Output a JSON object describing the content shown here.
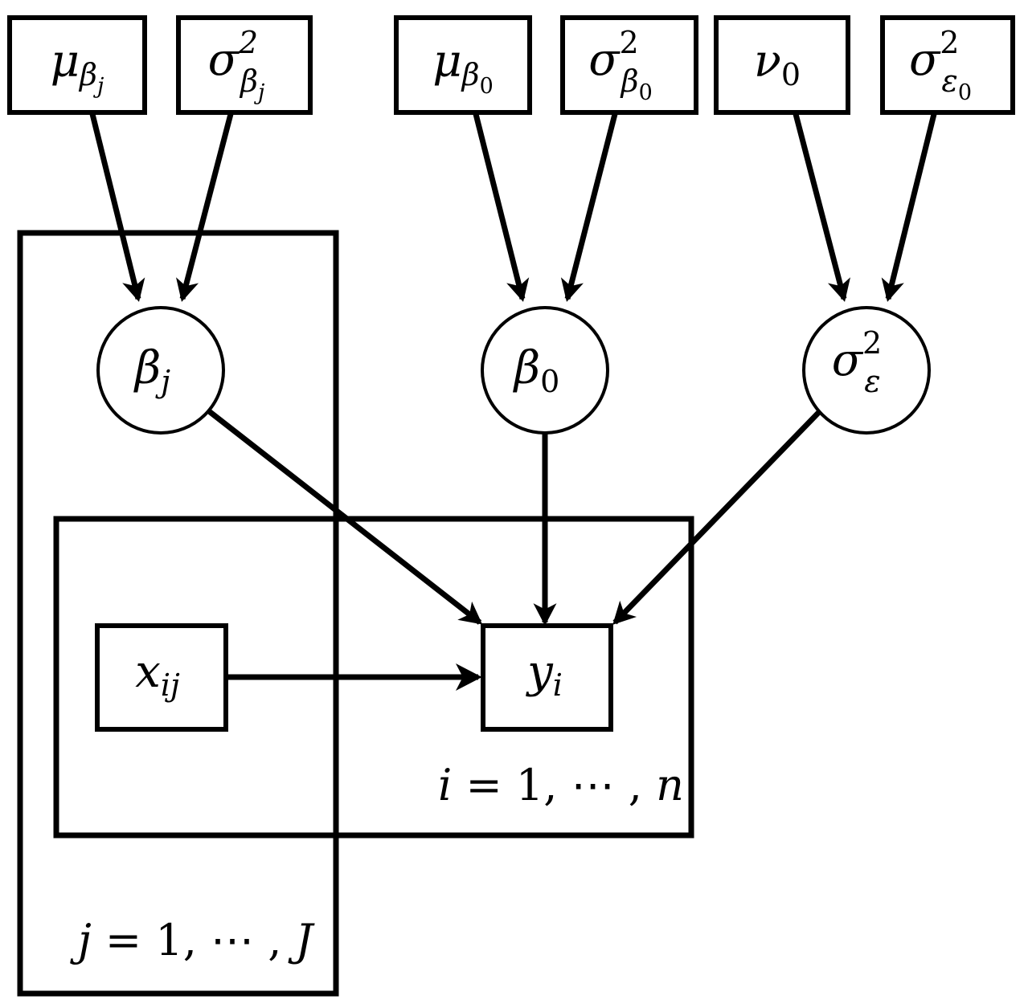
{
  "figure": {
    "type": "probabilistic-graphical-model",
    "title": "Bayesian hierarchical linear regression plate diagram",
    "background_color": "#ffffff",
    "stroke_color": "#000000"
  },
  "hyperparameter_nodes": [
    {
      "id": "mu_beta_j",
      "base": "μ",
      "sub": "β",
      "subsub": "j",
      "sup": "",
      "shape": "rectangle",
      "label": "mu_beta_j"
    },
    {
      "id": "sigma2_beta_j",
      "base": "σ",
      "sub": "β",
      "subsub": "j",
      "sup": "2",
      "shape": "rectangle",
      "label": "sigma2_beta_j"
    },
    {
      "id": "mu_beta_0",
      "base": "μ",
      "sub": "β",
      "subsub": "0",
      "sup": "",
      "shape": "rectangle",
      "label": "mu_beta_0"
    },
    {
      "id": "sigma2_beta_0",
      "base": "σ",
      "sub": "β",
      "subsub": "0",
      "sup": "2",
      "shape": "rectangle",
      "label": "sigma2_beta_0"
    },
    {
      "id": "nu_0",
      "base": "ν",
      "sub": "0",
      "subsub": "",
      "sup": "",
      "shape": "rectangle",
      "label": "nu_0"
    },
    {
      "id": "sigma2_eps_0",
      "base": "σ",
      "sub": "ε",
      "subsub": "0",
      "sup": "2",
      "shape": "rectangle",
      "label": "sigma2_epsilon_0"
    }
  ],
  "latent_nodes": [
    {
      "id": "beta_j",
      "base": "β",
      "sub": "j",
      "sup": "",
      "shape": "circle",
      "label": "beta_j"
    },
    {
      "id": "beta_0",
      "base": "β",
      "sub": "0",
      "sup": "",
      "shape": "circle",
      "label": "beta_0"
    },
    {
      "id": "sigma2_e",
      "base": "σ",
      "sub": "ε",
      "sup": "2",
      "shape": "circle",
      "label": "sigma2_epsilon"
    }
  ],
  "observed_nodes": [
    {
      "id": "x_ij",
      "base": "x",
      "sub": "ij",
      "shape": "rectangle",
      "label": "x_ij"
    },
    {
      "id": "y_i",
      "base": "y",
      "sub": "i",
      "shape": "rectangle",
      "label": "y_i"
    }
  ],
  "plates": [
    {
      "id": "plate_j",
      "label": "j = 1, ⋯ , J",
      "index": "j",
      "from": "1",
      "to": "J"
    },
    {
      "id": "plate_i",
      "label": "i = 1, ⋯ , n",
      "index": "i",
      "from": "1",
      "to": "n"
    }
  ],
  "edges": [
    {
      "from": "mu_beta_j",
      "to": "beta_j",
      "arrow": true
    },
    {
      "from": "sigma2_beta_j",
      "to": "beta_j",
      "arrow": true
    },
    {
      "from": "mu_beta_0",
      "to": "beta_0",
      "arrow": true
    },
    {
      "from": "sigma2_beta_0",
      "to": "beta_0",
      "arrow": true
    },
    {
      "from": "nu_0",
      "to": "sigma2_e",
      "arrow": true
    },
    {
      "from": "sigma2_eps_0",
      "to": "sigma2_e",
      "arrow": true
    },
    {
      "from": "beta_j",
      "to": "y_i",
      "arrow": true
    },
    {
      "from": "beta_0",
      "to": "y_i",
      "arrow": true
    },
    {
      "from": "sigma2_e",
      "to": "y_i",
      "arrow": true
    },
    {
      "from": "x_ij",
      "to": "y_i",
      "arrow": true
    }
  ]
}
